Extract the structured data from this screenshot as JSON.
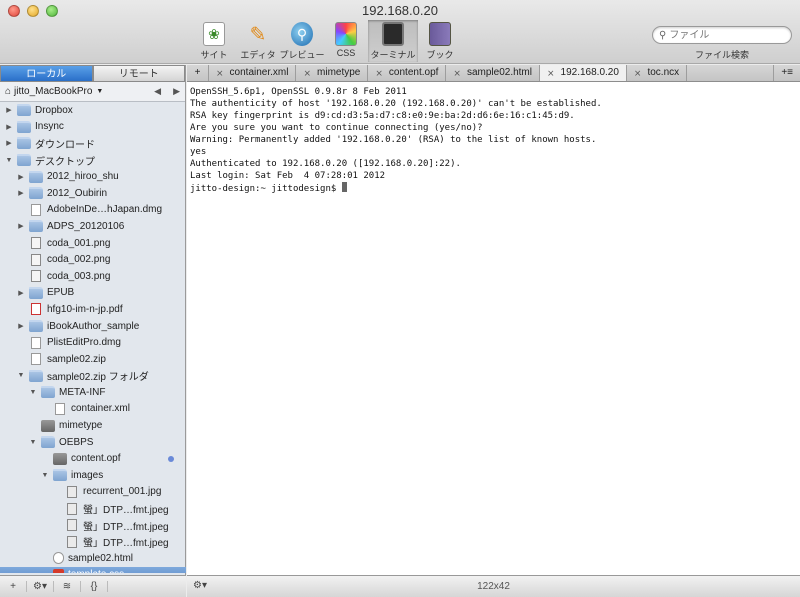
{
  "window": {
    "title": "192.168.0.20"
  },
  "toolbar": {
    "items": [
      {
        "label": "サイト",
        "icon": "site-leaf-icon"
      },
      {
        "label": "エディタ",
        "icon": "pencil-icon"
      },
      {
        "label": "プレビュー",
        "icon": "magnifier-globe-icon"
      },
      {
        "label": "CSS",
        "icon": "css-color-icon"
      },
      {
        "label": "ターミナル",
        "icon": "terminal-icon",
        "active": true
      },
      {
        "label": "ブック",
        "icon": "book-icon"
      }
    ],
    "search_placeholder": "ファイル",
    "search_label": "ファイル検索"
  },
  "sidebar": {
    "tabs": [
      "ローカル",
      "リモート"
    ],
    "host": "jitto_MacBookPro",
    "tree": [
      {
        "label": "Dropbox",
        "type": "folder",
        "depth": 0,
        "expanded": false
      },
      {
        "label": "Insync",
        "type": "folder",
        "depth": 0,
        "expanded": false
      },
      {
        "label": "ダウンロード",
        "type": "folder",
        "depth": 0,
        "expanded": false
      },
      {
        "label": "デスクトップ",
        "type": "folder",
        "depth": 0,
        "expanded": true
      },
      {
        "label": "2012_hiroo_shu",
        "type": "folder",
        "depth": 1,
        "expanded": false
      },
      {
        "label": "2012_Oubirin",
        "type": "folder",
        "depth": 1,
        "expanded": false
      },
      {
        "label": "AdobeInDe…hJapan.dmg",
        "type": "doc",
        "depth": 1
      },
      {
        "label": "ADPS_20120106",
        "type": "folder",
        "depth": 1,
        "expanded": false
      },
      {
        "label": "coda_001.png",
        "type": "png",
        "depth": 1
      },
      {
        "label": "coda_002.png",
        "type": "png",
        "depth": 1
      },
      {
        "label": "coda_003.png",
        "type": "png",
        "depth": 1
      },
      {
        "label": "EPUB",
        "type": "folder",
        "depth": 1,
        "expanded": false
      },
      {
        "label": "hfg10-im-n-jp.pdf",
        "type": "pdf",
        "depth": 1
      },
      {
        "label": "iBookAuthor_sample",
        "type": "folder",
        "depth": 1,
        "expanded": false
      },
      {
        "label": "PlistEditPro.dmg",
        "type": "doc",
        "depth": 1
      },
      {
        "label": "sample02.zip",
        "type": "doc",
        "depth": 1
      },
      {
        "label": "sample02.zip フォルダ",
        "type": "folder",
        "depth": 1,
        "expanded": true
      },
      {
        "label": "META-INF",
        "type": "folder",
        "depth": 2,
        "expanded": true
      },
      {
        "label": "container.xml",
        "type": "doc",
        "depth": 3
      },
      {
        "label": "mimetype",
        "type": "dmg",
        "depth": 2
      },
      {
        "label": "OEBPS",
        "type": "folder",
        "depth": 2,
        "expanded": true
      },
      {
        "label": "content.opf",
        "type": "dmg",
        "depth": 3,
        "bullet": true
      },
      {
        "label": "images",
        "type": "folder",
        "depth": 3,
        "expanded": true
      },
      {
        "label": "recurrent_001.jpg",
        "type": "jpg",
        "depth": 4
      },
      {
        "label": "螢」DTP…fmt.jpeg",
        "type": "jpg",
        "depth": 4
      },
      {
        "label": "螢」DTP…fmt.jpeg",
        "type": "jpg",
        "depth": 4
      },
      {
        "label": "螢」DTP…fmt.jpeg",
        "type": "jpg",
        "depth": 4
      },
      {
        "label": "sample02.html",
        "type": "html",
        "depth": 3
      },
      {
        "label": "template.css",
        "type": "css",
        "depth": 3,
        "selected": true
      }
    ],
    "bottom_icons": [
      "add-icon",
      "gear-icon",
      "rss-icon",
      "braces-icon"
    ]
  },
  "tabs": [
    {
      "label": "container.xml"
    },
    {
      "label": "mimetype"
    },
    {
      "label": "content.opf"
    },
    {
      "label": "sample02.html"
    },
    {
      "label": "192.168.0.20",
      "active": true
    },
    {
      "label": "toc.ncx"
    }
  ],
  "terminal": {
    "lines": [
      "OpenSSH_5.6p1, OpenSSL 0.9.8r 8 Feb 2011",
      "The authenticity of host '192.168.0.20 (192.168.0.20)' can't be established.",
      "RSA key fingerprint is d9:cd:d3:5a:d7:c8:e0:9e:ba:2d:d6:6e:16:c1:45:d9.",
      "Are you sure you want to continue connecting (yes/no)?",
      "Warning: Permanently added '192.168.0.20' (RSA) to the list of known hosts.",
      "yes",
      "Authenticated to 192.168.0.20 ([192.168.0.20]:22).",
      "Last login: Sat Feb  4 07:28:01 2012"
    ],
    "prompt": "jitto-design:~ jittodesign$ "
  },
  "status": {
    "size": "122x42"
  }
}
